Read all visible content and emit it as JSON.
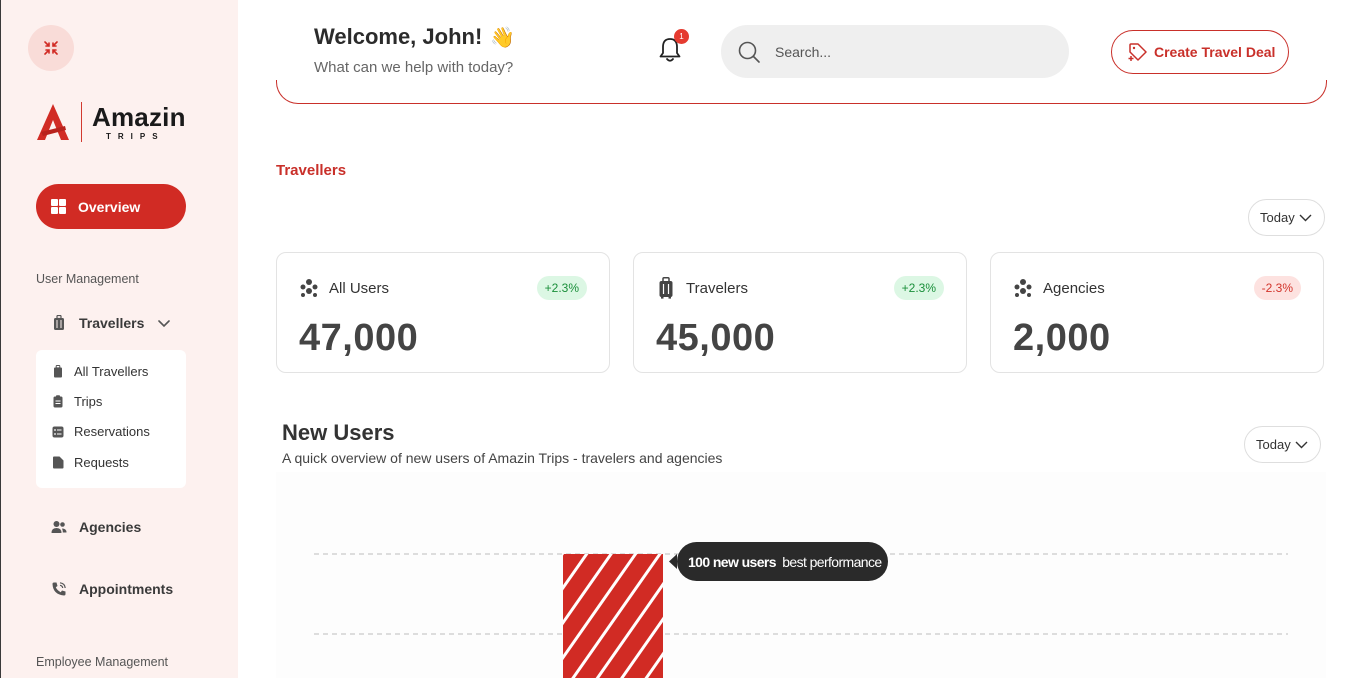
{
  "sidebar": {
    "brand": {
      "name": "Amazin",
      "sub": "TRIPS"
    },
    "overview_label": "Overview",
    "user_management_label": "User Management",
    "travellers_label": "Travellers",
    "sub_items": [
      {
        "label": "All Travellers",
        "icon": "luggage-icon"
      },
      {
        "label": "Trips",
        "icon": "clipboard-icon"
      },
      {
        "label": "Reservations",
        "icon": "checklist-icon"
      },
      {
        "label": "Requests",
        "icon": "document-icon"
      }
    ],
    "agencies_label": "Agencies",
    "appointments_label": "Appointments",
    "employee_management_label": "Employee Management"
  },
  "header": {
    "welcome": "Welcome, John!",
    "wave": "👋",
    "subtitle": "What can we help with today?",
    "notification_count": "1",
    "search_placeholder": "Search...",
    "create_label": "Create Travel Deal"
  },
  "travellers": {
    "title": "Travellers",
    "period": "Today",
    "stats": [
      {
        "label": "All Users",
        "value": "47,000",
        "change": "+2.3%",
        "trend": "up"
      },
      {
        "label": "Travelers",
        "value": "45,000",
        "change": "+2.3%",
        "trend": "up"
      },
      {
        "label": "Agencies",
        "value": "2,000",
        "change": "-2.3%",
        "trend": "down"
      }
    ]
  },
  "new_users": {
    "title": "New Users",
    "subtitle": "A quick overview of new users of Amazin Trips - travelers and agencies",
    "period": "Today",
    "tooltip_bold": "100 new users",
    "tooltip_rest": "best performance"
  },
  "colors": {
    "accent": "#d12b24",
    "sidebar_bg": "#fdf1ef",
    "up": "#1a8f3a",
    "down": "#d2342b"
  }
}
